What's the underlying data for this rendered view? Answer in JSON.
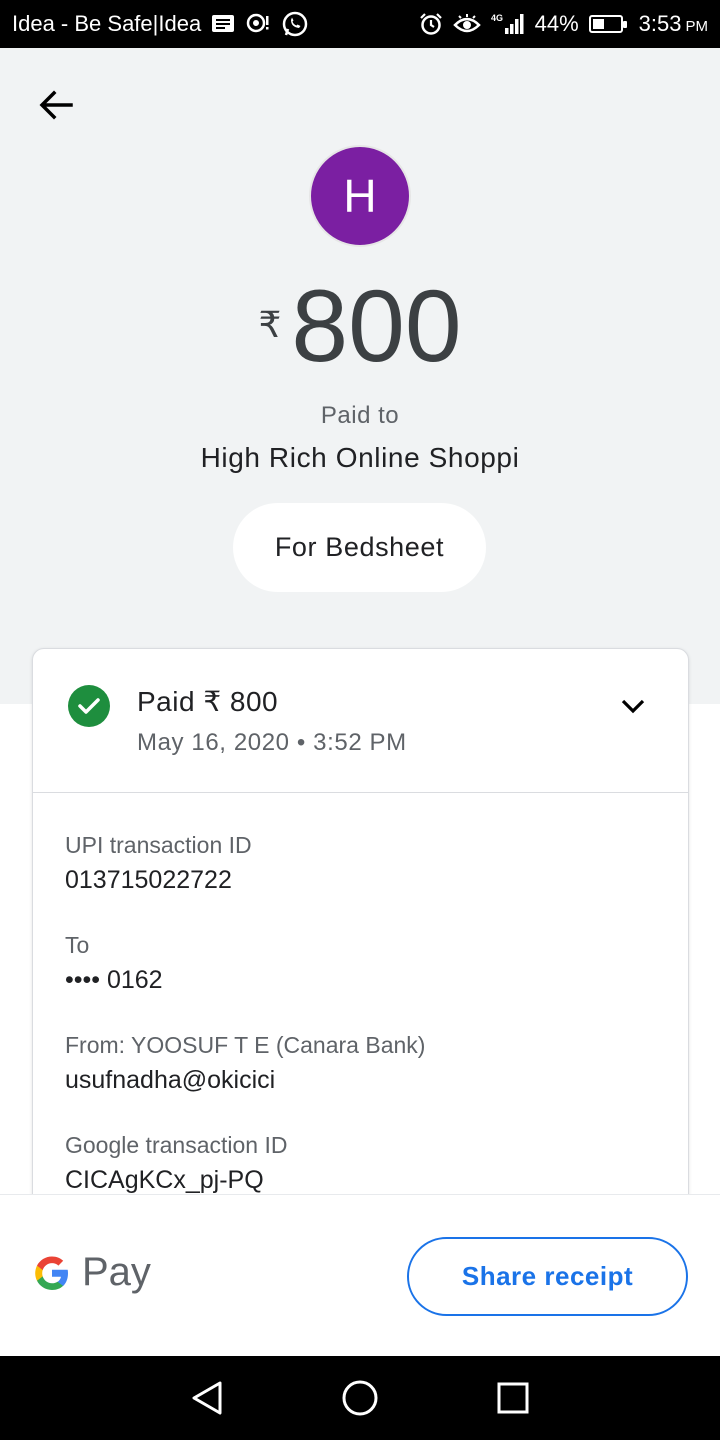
{
  "status_bar": {
    "carrier": "Idea - Be Safe|Idea",
    "network": "4G",
    "battery": "44%",
    "battery_level": 0.44,
    "time": "3:53",
    "time_suffix": "PM"
  },
  "header": {
    "avatar_letter": "H",
    "avatar_color": "#7b1fa2",
    "currency": "₹",
    "amount": "800",
    "paid_to_label": "Paid to",
    "payee": "High Rich Online Shoppi",
    "note": "For Bedsheet"
  },
  "card": {
    "status_title": "Paid ₹ 800",
    "date": "May 16, 2020 • 3:52 PM",
    "status_color": "#1e8e3e",
    "details": [
      {
        "label": "UPI transaction ID",
        "value": "013715022722"
      },
      {
        "label": "To",
        "value": "•••• 0162"
      },
      {
        "label": "From: YOOSUF T E (Canara Bank)",
        "value": "usufnadha@okicici"
      },
      {
        "label": "Google transaction ID",
        "value": "CICAgKCx_pj-PQ"
      }
    ]
  },
  "footer": {
    "brand": "Pay",
    "share_label": "Share receipt",
    "accent_color": "#1a73e8"
  },
  "icons": [
    "back-arrow-icon",
    "check-icon",
    "chevron-down-icon",
    "google-g-icon",
    "nav-back-icon",
    "nav-home-icon",
    "nav-recents-icon"
  ]
}
